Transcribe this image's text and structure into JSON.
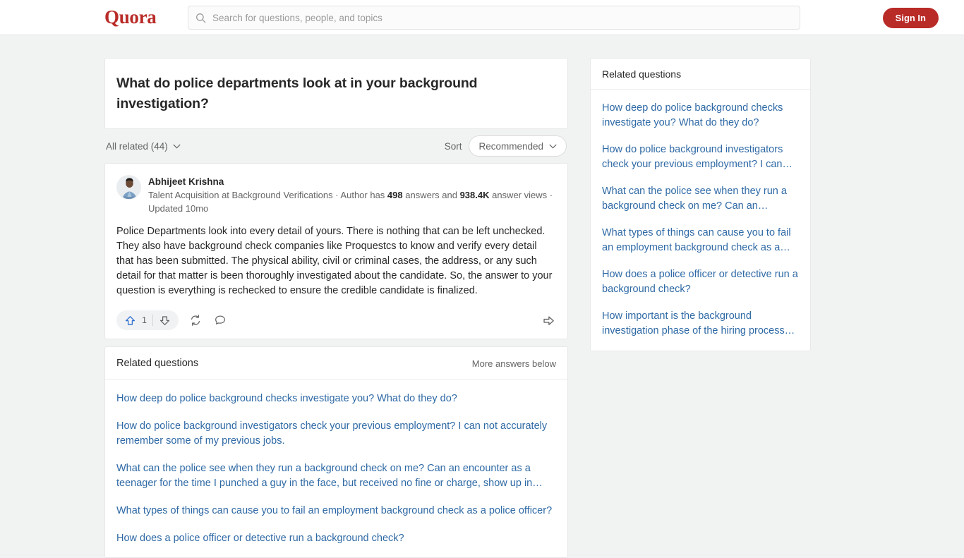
{
  "header": {
    "logo": "Quora",
    "search": {
      "placeholder": "Search for questions, people, and topics",
      "value": "",
      "icon": "search-icon"
    },
    "signin_label": "Sign In"
  },
  "question": {
    "title": "What do police departments look at in your background investigation?"
  },
  "filters": {
    "related_label": "All related (44)",
    "sort_label": "Sort",
    "sort_value": "Recommended"
  },
  "answer": {
    "author_name": "Abhijeet Krishna",
    "credential_prefix": "Talent Acquisition at Background Verifications · Author has ",
    "answers_count": "498",
    "credential_middle": " answers and ",
    "views_count": "938.4K",
    "credential_suffix": " answer views · Updated 10mo",
    "body": "Police Departments look into every detail of yours. There is nothing that can be left unchecked. They also have background check companies like Proquestcs to know and verify every detail that has been submitted. The physical ability, civil or criminal cases, the address, or any such detail for that matter is been thoroughly investigated about the candidate. So, the answer to your question is everything is rechecked to ensure the credible candidate is finalized.",
    "upvote_count": "1",
    "icons": {
      "upvote": "upvote-arrow-icon",
      "downvote": "downvote-arrow-icon",
      "repost": "repost-icon",
      "comment": "comment-icon",
      "share": "share-icon"
    }
  },
  "related_main": {
    "title": "Related questions",
    "more_label": "More answers below",
    "items": [
      "How deep do police background checks investigate you? What do they do?",
      "How do police background investigators check your previous employment? I can not accurately remember some of my previous jobs.",
      "What can the police see when they run a background check on me? Can an encounter as a teenager for the time I punched a guy in the face, but received no fine or charge, show up in…",
      "What types of things can cause you to fail an employment background check as a police officer?",
      "How does a police officer or detective run a background check?"
    ]
  },
  "sidebar": {
    "title": "Related questions",
    "items": [
      "How deep do police background checks investigate you? What do they do?",
      "How do police background investigators check your previous employment? I can…",
      "What can the police see when they run a background check on me? Can an…",
      "What types of things can cause you to fail an employment background check as a…",
      "How does a police officer or detective run a background check?",
      "How important is the background investigation phase of the hiring process…"
    ]
  },
  "colors": {
    "brand_red": "#b92b27",
    "link_blue": "#2e69a5",
    "upvote_blue": "#2b6dd1",
    "page_bg": "#f1f2f2"
  }
}
